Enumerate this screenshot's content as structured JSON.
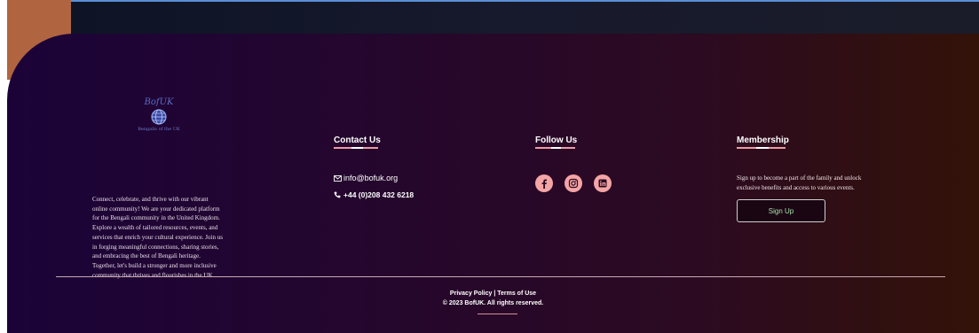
{
  "about": {
    "logo_text": "BofUK",
    "logo_sub": "Bengalis of the UK",
    "lines": [
      "Connect, celebrate, and thrive with our vibrant",
      "online community! We are your dedicated platform",
      "for the Bengali community in the United Kingdom.",
      "Explore a wealth of tailored resources, events, and",
      "services that enrich your cultural experience. Join us",
      "in forging meaningful connections, sharing stories,",
      "and embracing the best of Bengali heritage.",
      "Together, let's build a stronger and more inclusive",
      "community that thrives and flourishes in the UK."
    ]
  },
  "contact": {
    "title": "Contact Us",
    "email": "info@bofuk.org",
    "phone": "+44 (0)208 432 6218",
    "email_icon": "mail-icon",
    "phone_icon": "phone-icon"
  },
  "follow": {
    "title": "Follow Us",
    "icons": [
      "facebook-icon",
      "instagram-icon",
      "linkedin-icon"
    ]
  },
  "membership": {
    "title": "Membership",
    "lines": [
      "Sign up to become a part of the family and unlock",
      "exclusive benefits and access to various events."
    ],
    "button": "Sign Up"
  },
  "bottom": {
    "links": "Privacy Policy | Terms of Use",
    "copyright": "© 2023 BofUK. All rights reserved."
  },
  "colors": {
    "accent_pink": "#f4a5a5",
    "underline": "#ee9aa3",
    "signup_text": "#a8e0ad",
    "top_border": "#5a8fd6",
    "orange_block": "#b0643f"
  }
}
